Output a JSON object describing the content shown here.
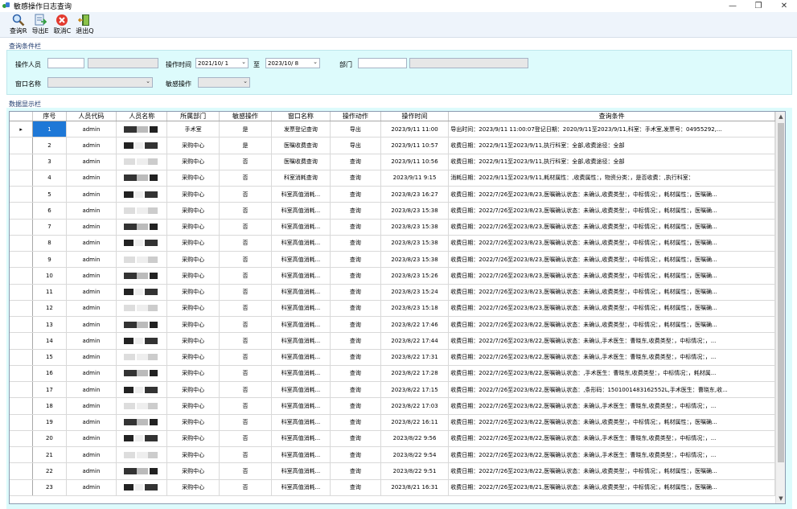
{
  "window": {
    "title": "敏感操作日志查询",
    "controls": {
      "minimize": "—",
      "maximize": "❐",
      "close": "✕"
    }
  },
  "toolbar": {
    "query_label": "查询R",
    "export_label": "导出E",
    "cancel_label": "取消C",
    "exit_label": "退出Q"
  },
  "query_section": {
    "title": "查询条件栏",
    "operator_label": "操作人员",
    "operator_value": "",
    "operator_name_value": "",
    "op_time_label": "操作时间",
    "start_date": "2021/10/ 1",
    "to_label": "至",
    "end_date": "2023/10/ 8",
    "dept_label": "部门",
    "dept_value": "",
    "dept_name_value": "",
    "window_name_label": "窗口名称",
    "window_name_value": "",
    "sensitive_label": "敏感操作",
    "sensitive_value": ""
  },
  "data_section": {
    "title": "数据显示栏",
    "columns": [
      "序号",
      "人员代码",
      "人员名称",
      "所属部门",
      "敏感操作",
      "窗口名称",
      "操作动作",
      "操作时间",
      "查询条件"
    ],
    "rows": [
      {
        "no": "1",
        "code": "admin",
        "dept": "手术室",
        "sensitive": "是",
        "window": "发票登记查询",
        "action": "导出",
        "time": "2023/9/11 11:00",
        "cond": "导出时间：2023/9/11 11:00:07登记日期：2020/9/11至2023/9/11,科室：手术室,发票号：04955292,..."
      },
      {
        "no": "2",
        "code": "admin",
        "dept": "采购中心",
        "sensitive": "是",
        "window": "医嘱收费查询",
        "action": "导出",
        "time": "2023/9/11 10:57",
        "cond": "收费日期：2022/9/11至2023/9/11,执行科室：全部,收费途径：全部"
      },
      {
        "no": "3",
        "code": "admin",
        "dept": "采购中心",
        "sensitive": "否",
        "window": "医嘱收费查询",
        "action": "查询",
        "time": "2023/9/11 10:56",
        "cond": "收费日期：2022/9/11至2023/9/11,执行科室：全部,收费途径：全部"
      },
      {
        "no": "4",
        "code": "admin",
        "dept": "采购中心",
        "sensitive": "否",
        "window": "科室消耗查询",
        "action": "查询",
        "time": "2023/9/11 9:15",
        "cond": "消耗日期：2022/9/11至2023/9/11,耗材属性：,收费属性：，物资分类：，是否收费：,执行科室："
      },
      {
        "no": "5",
        "code": "admin",
        "dept": "采购中心",
        "sensitive": "否",
        "window": "科室高值消耗...",
        "action": "查询",
        "time": "2023/8/23 16:27",
        "cond": "收费日期：2022/7/26至2023/8/23,医嘱确认状态：未确认,收费类型：，中标情况：，耗材属性：，医嘱确..."
      },
      {
        "no": "6",
        "code": "admin",
        "dept": "采购中心",
        "sensitive": "否",
        "window": "科室高值消耗...",
        "action": "查询",
        "time": "2023/8/23 15:38",
        "cond": "收费日期：2022/7/26至2023/8/23,医嘱确认状态：未确认,收费类型：，中标情况：，耗材属性：，医嘱确..."
      },
      {
        "no": "7",
        "code": "admin",
        "dept": "采购中心",
        "sensitive": "否",
        "window": "科室高值消耗...",
        "action": "查询",
        "time": "2023/8/23 15:38",
        "cond": "收费日期：2022/7/26至2023/8/23,医嘱确认状态：未确认,收费类型：，中标情况：，耗材属性：，医嘱确..."
      },
      {
        "no": "8",
        "code": "admin",
        "dept": "采购中心",
        "sensitive": "否",
        "window": "科室高值消耗...",
        "action": "查询",
        "time": "2023/8/23 15:38",
        "cond": "收费日期：2022/7/26至2023/8/23,医嘱确认状态：未确认,收费类型：，中标情况：，耗材属性：，医嘱确..."
      },
      {
        "no": "9",
        "code": "admin",
        "dept": "采购中心",
        "sensitive": "否",
        "window": "科室高值消耗...",
        "action": "查询",
        "time": "2023/8/23 15:38",
        "cond": "收费日期：2022/7/26至2023/8/23,医嘱确认状态：未确认,收费类型：，中标情况：，耗材属性：，医嘱确..."
      },
      {
        "no": "10",
        "code": "admin",
        "dept": "采购中心",
        "sensitive": "否",
        "window": "科室高值消耗...",
        "action": "查询",
        "time": "2023/8/23 15:26",
        "cond": "收费日期：2022/7/26至2023/8/23,医嘱确认状态：未确认,收费类型：，中标情况：，耗材属性：，医嘱确..."
      },
      {
        "no": "11",
        "code": "admin",
        "dept": "采购中心",
        "sensitive": "否",
        "window": "科室高值消耗...",
        "action": "查询",
        "time": "2023/8/23 15:24",
        "cond": "收费日期：2022/7/26至2023/8/23,医嘱确认状态：未确认,收费类型：，中标情况：，耗材属性：，医嘱确..."
      },
      {
        "no": "12",
        "code": "admin",
        "dept": "采购中心",
        "sensitive": "否",
        "window": "科室高值消耗...",
        "action": "查询",
        "time": "2023/8/23 15:18",
        "cond": "收费日期：2022/7/26至2023/8/23,医嘱确认状态：未确认,收费类型：，中标情况：，耗材属性：，医嘱确..."
      },
      {
        "no": "13",
        "code": "admin",
        "dept": "采购中心",
        "sensitive": "否",
        "window": "科室高值消耗...",
        "action": "查询",
        "time": "2023/8/22 17:46",
        "cond": "收费日期：2022/7/26至2023/8/22,医嘱确认状态：未确认,收费类型：，中标情况：，耗材属性：，医嘱确..."
      },
      {
        "no": "14",
        "code": "admin",
        "dept": "采购中心",
        "sensitive": "否",
        "window": "科室高值消耗...",
        "action": "查询",
        "time": "2023/8/22 17:44",
        "cond": "收费日期：2022/7/26至2023/8/22,医嘱确认状态：未确认,手术医生：曹晓东,收费类型：，中标情况：，..."
      },
      {
        "no": "15",
        "code": "admin",
        "dept": "采购中心",
        "sensitive": "否",
        "window": "科室高值消耗...",
        "action": "查询",
        "time": "2023/8/22 17:31",
        "cond": "收费日期：2022/7/26至2023/8/22,医嘱确认状态：未确认,手术医生：曹晓东,收费类型：，中标情况：，..."
      },
      {
        "no": "16",
        "code": "admin",
        "dept": "采购中心",
        "sensitive": "否",
        "window": "科室高值消耗...",
        "action": "查询",
        "time": "2023/8/22 17:28",
        "cond": "收费日期：2022/7/26至2023/8/22,医嘱确认状态：,手术医生：曹晓东,收费类型：，中标情况：，耗材属..."
      },
      {
        "no": "17",
        "code": "admin",
        "dept": "采购中心",
        "sensitive": "否",
        "window": "科室高值消耗...",
        "action": "查询",
        "time": "2023/8/22 17:15",
        "cond": "收费日期：2022/7/26至2023/8/22,医嘱确认状态：,条形码：1501001483162552L,手术医生：曹晓东,收..."
      },
      {
        "no": "18",
        "code": "admin",
        "dept": "采购中心",
        "sensitive": "否",
        "window": "科室高值消耗...",
        "action": "查询",
        "time": "2023/8/22 17:03",
        "cond": "收费日期：2022/7/26至2023/8/22,医嘱确认状态：未确认,手术医生：曹晓东,收费类型：，中标情况：，..."
      },
      {
        "no": "19",
        "code": "admin",
        "dept": "采购中心",
        "sensitive": "否",
        "window": "科室高值消耗...",
        "action": "查询",
        "time": "2023/8/22 16:11",
        "cond": "收费日期：2022/7/26至2023/8/22,医嘱确认状态：未确认,收费类型：，中标情况：，耗材属性：，医嘱确..."
      },
      {
        "no": "20",
        "code": "admin",
        "dept": "采购中心",
        "sensitive": "否",
        "window": "科室高值消耗...",
        "action": "查询",
        "time": "2023/8/22 9:56",
        "cond": "收费日期：2022/7/26至2023/8/22,医嘱确认状态：未确认,手术医生：曹晓东,收费类型：，中标情况：，..."
      },
      {
        "no": "21",
        "code": "admin",
        "dept": "采购中心",
        "sensitive": "否",
        "window": "科室高值消耗...",
        "action": "查询",
        "time": "2023/8/22 9:54",
        "cond": "收费日期：2022/7/26至2023/8/22,医嘱确认状态：未确认,手术医生：曹晓东,收费类型：，中标情况：，..."
      },
      {
        "no": "22",
        "code": "admin",
        "dept": "采购中心",
        "sensitive": "否",
        "window": "科室高值消耗...",
        "action": "查询",
        "time": "2023/8/22 9:51",
        "cond": "收费日期：2022/7/26至2023/8/22,医嘱确认状态：未确认,收费类型：，中标情况：，耗材属性：，医嘱确..."
      },
      {
        "no": "23",
        "code": "admin",
        "dept": "采购中心",
        "sensitive": "否",
        "window": "科室高值消耗...",
        "action": "查询",
        "time": "2023/8/21 16:31",
        "cond": "收费日期：2022/7/26至2023/8/21,医嘱确认状态：未确认,收费类型：，中标情况：，耗材属性：，医嘱确..."
      }
    ]
  },
  "colors": {
    "selected": "#1e78d7",
    "panel_bg": "#ddfbfc",
    "toolbar_bg": "#eef4fb"
  }
}
